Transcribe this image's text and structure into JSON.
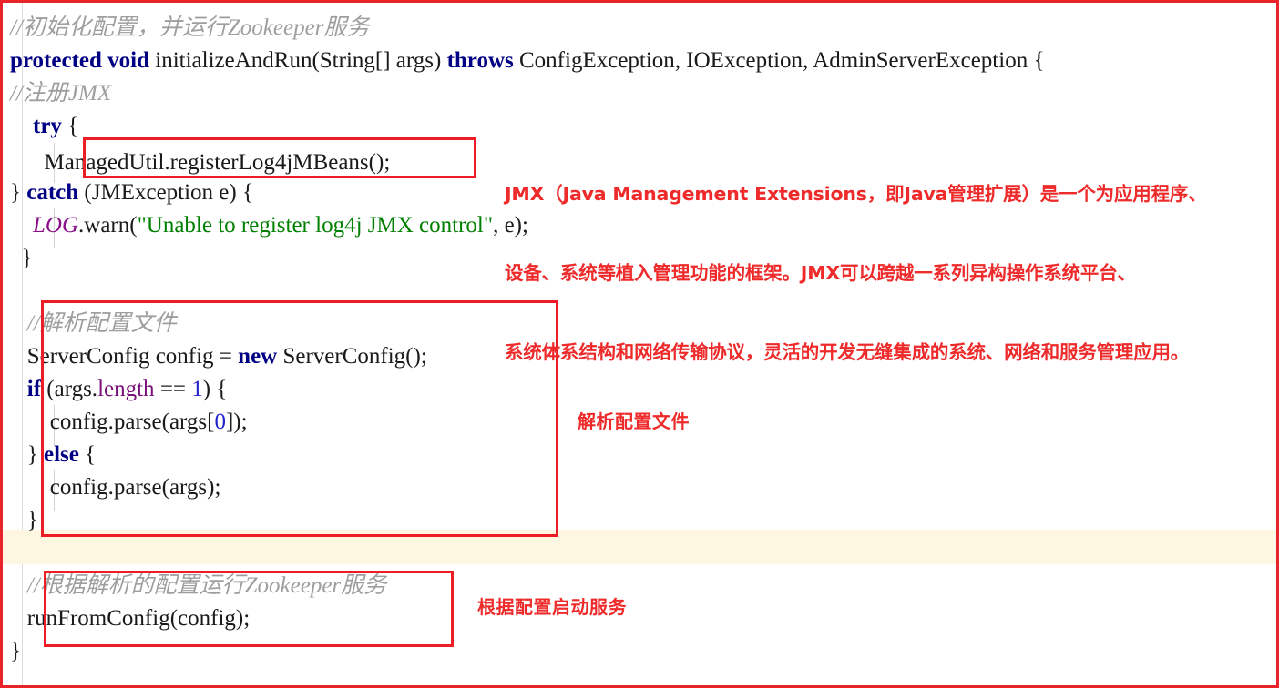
{
  "document": {
    "kind": "annotated-java-source-screenshot",
    "language": "Java",
    "outer_border_color": "#e8232a",
    "highlight_box_color": "#ee1c25",
    "annotation_color": "#ee2a2a",
    "current_line_highlight_color": "#fdf6e0"
  },
  "code": {
    "lines": [
      {
        "id": "l1",
        "text": "//初始化配置，并运行Zookeeper服务"
      },
      {
        "id": "l2",
        "text": "protected void initializeAndRun(String[] args) throws ConfigException, IOException, AdminServerException {"
      },
      {
        "id": "l3",
        "text": "    //注册JMX"
      },
      {
        "id": "l4",
        "text": "    try {"
      },
      {
        "id": "l5",
        "text": "        ManagedUtil.registerLog4jMBeans();"
      },
      {
        "id": "l6",
        "text": "    } catch (JMException e) {"
      },
      {
        "id": "l7",
        "text": "        LOG.warn(\"Unable to register log4j JMX control\", e);"
      },
      {
        "id": "l8",
        "text": "    }"
      },
      {
        "id": "l9",
        "text": ""
      },
      {
        "id": "l10",
        "text": "    //解析配置文件"
      },
      {
        "id": "l11",
        "text": "    ServerConfig config = new ServerConfig();"
      },
      {
        "id": "l12",
        "text": "    if (args.length == 1) {"
      },
      {
        "id": "l13",
        "text": "        config.parse(args[0]);"
      },
      {
        "id": "l14",
        "text": "    } else {"
      },
      {
        "id": "l15",
        "text": "        config.parse(args);"
      },
      {
        "id": "l16",
        "text": "    }"
      },
      {
        "id": "l17",
        "text": ""
      },
      {
        "id": "l18",
        "text": "    //根据解析的配置运行Zookeeper服务"
      },
      {
        "id": "l19",
        "text": "    runFromConfig(config);"
      },
      {
        "id": "l20",
        "text": "}"
      }
    ],
    "tokens": {
      "c1_comment": "//初始化配置，并运行Zookeeper服务",
      "s2_protected": "protected",
      "s2_void": "void",
      "s2_sig": " initializeAndRun(String[] args) ",
      "s2_throws": "throws",
      "s2_exceptions": " ConfigException, IOException, AdminServerException {",
      "c3_comment": "//注册JMX",
      "s4_try": "try",
      "s4_brace": " {",
      "s5_call": "ManagedUtil.registerLog4jMBeans();",
      "s6_close": "} ",
      "s6_catch": "catch",
      "s6_rest": " (JMException e) {",
      "s7_log": "LOG",
      "s7_warn": ".warn(",
      "s7_string": "\"Unable to register log4j JMX control\"",
      "s7_tail": ", e);",
      "s8_close": "}",
      "c10_comment": "//解析配置文件",
      "s11_decl": "ServerConfig config = ",
      "s11_new": "new",
      "s11_ctor": " ServerConfig();",
      "s11_part_a": "ServerConfig config = ",
      "s12_if": "if",
      "s12_open": " (args.",
      "s12_length": "length",
      "s12_eq": " == ",
      "s12_one": "1",
      "s12_tail": ") {",
      "s13_call_a": "config.parse(args[",
      "s13_index": "0",
      "s13_call_b": "]);",
      "s14_close": "} ",
      "s14_else": "else",
      "s14_open": " {",
      "s15_call": "config.parse(args);",
      "s16_close": "}",
      "c18_comment": "//根据解析的配置运行Zookeeper服务",
      "s19_call": "runFromConfig(config);",
      "s20_close": "}"
    }
  },
  "highlight_boxes": [
    {
      "id": "box-register-log4j-mbeans",
      "label": "ManagedUtil.registerLog4jMBeans();"
    },
    {
      "id": "box-parse-config-file",
      "label": "解析配置文件代码块"
    },
    {
      "id": "box-run-from-config",
      "label": "runFromConfig(config);"
    }
  ],
  "annotations": {
    "jmx": {
      "line1": "JMX（Java Management Extensions，即Java管理扩展）是一个为应用程序、",
      "line2": "设备、系统等植入管理功能的框架。JMX可以跨越一系列异构操作系统平台、",
      "line3": "系统体系结构和网络传输协议，灵活的开发无缝集成的系统、网络和服务管理应用。"
    },
    "parse_config": "解析配置文件",
    "run_service": "根据配置启动服务"
  }
}
